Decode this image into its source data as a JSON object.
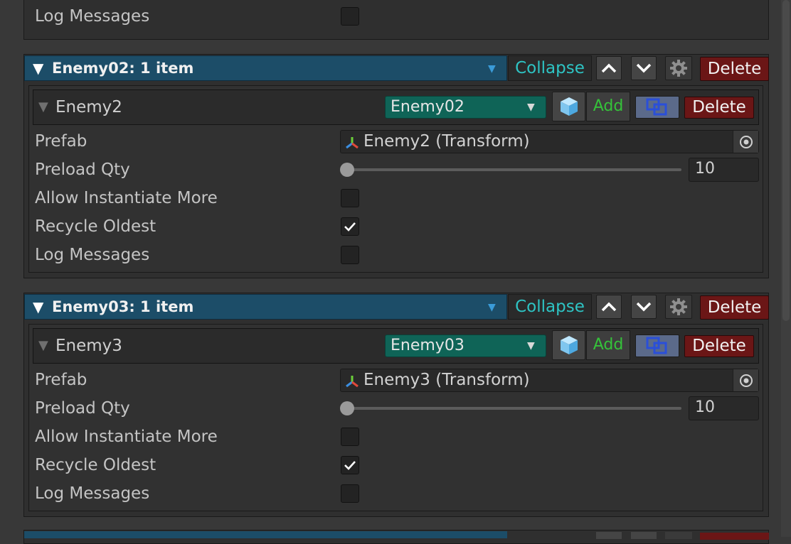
{
  "top_partial": {
    "log_messages_label": "Log Messages",
    "log_messages_checked": false
  },
  "groups": [
    {
      "title": "Enemy02: 1 item",
      "collapse_label": "Collapse",
      "delete_label": "Delete",
      "item": {
        "name": "Enemy2",
        "prefab_select": "Enemy02",
        "add_label": "Add",
        "delete_label": "Delete",
        "fields": {
          "prefab_label": "Prefab",
          "prefab_value": "Enemy2 (Transform)",
          "preload_label": "Preload Qty",
          "preload_value": "10",
          "allow_label": "Allow Instantiate More",
          "allow_checked": false,
          "recycle_label": "Recycle Oldest",
          "recycle_checked": true,
          "log_label": "Log Messages",
          "log_checked": false
        }
      }
    },
    {
      "title": "Enemy03: 1 item",
      "collapse_label": "Collapse",
      "delete_label": "Delete",
      "item": {
        "name": "Enemy3",
        "prefab_select": "Enemy03",
        "add_label": "Add",
        "delete_label": "Delete",
        "fields": {
          "prefab_label": "Prefab",
          "prefab_value": "Enemy3 (Transform)",
          "preload_label": "Preload Qty",
          "preload_value": "10",
          "allow_label": "Allow Instantiate More",
          "allow_checked": false,
          "recycle_label": "Recycle Oldest",
          "recycle_checked": true,
          "log_label": "Log Messages",
          "log_checked": false
        }
      }
    }
  ],
  "icons": {
    "group_toggle": "triangle-down-icon",
    "dropdown": "dropdown-arrow-icon",
    "move_up": "chevron-up-icon",
    "move_down": "chevron-down-icon",
    "settings": "gear-icon",
    "prefab": "cube-icon",
    "clone": "clone-icon",
    "object_picker": "target-circle-icon",
    "transform": "transform-axis-icon"
  },
  "colors": {
    "group_header": "#1c4d68",
    "collapse_text": "#2ec4c4",
    "delete_button": "#6b1616",
    "prefab_dropdown": "#0f6457",
    "add_text": "#35c23a",
    "clone_button": "#5b6a8a"
  }
}
